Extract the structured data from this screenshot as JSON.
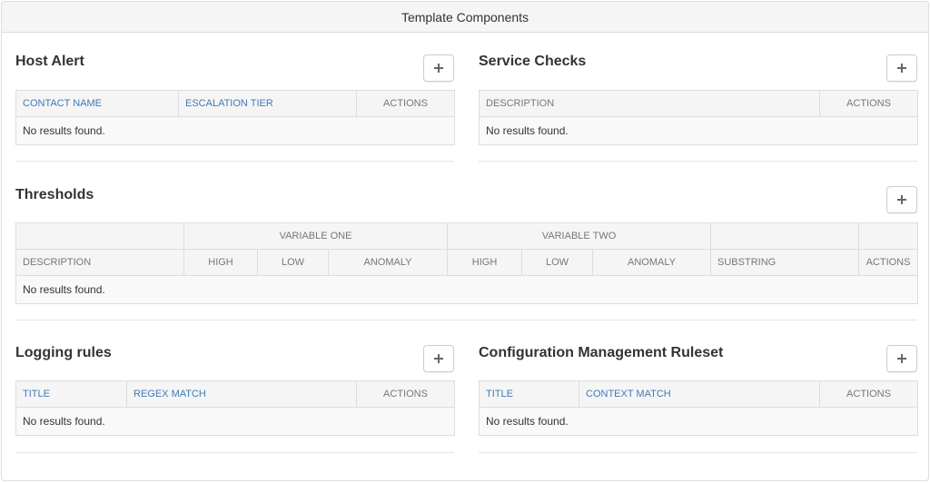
{
  "panel": {
    "title": "Template Components"
  },
  "empty_text": "No results found.",
  "host_alert": {
    "title": "Host Alert",
    "add_label": "+",
    "columns": [
      "CONTACT NAME",
      "ESCALATION TIER",
      "ACTIONS"
    ]
  },
  "service_checks": {
    "title": "Service Checks",
    "add_label": "+",
    "columns": [
      "DESCRIPTION",
      "ACTIONS"
    ]
  },
  "thresholds": {
    "title": "Thresholds",
    "add_label": "+",
    "group_headers": [
      "VARIABLE ONE",
      "VARIABLE TWO"
    ],
    "columns": [
      "DESCRIPTION",
      "HIGH",
      "LOW",
      "ANOMALY",
      "HIGH",
      "LOW",
      "ANOMALY",
      "SUBSTRING",
      "ACTIONS"
    ]
  },
  "logging_rules": {
    "title": "Logging rules",
    "add_label": "+",
    "columns": [
      "TITLE",
      "REGEX MATCH",
      "ACTIONS"
    ]
  },
  "config_mgmt": {
    "title": "Configuration Management Ruleset",
    "add_label": "+",
    "columns": [
      "TITLE",
      "CONTEXT MATCH",
      "ACTIONS"
    ]
  },
  "colors": {
    "link": "#3f7ab8",
    "header_bg": "#f5f5f5",
    "border": "#dddddd"
  }
}
